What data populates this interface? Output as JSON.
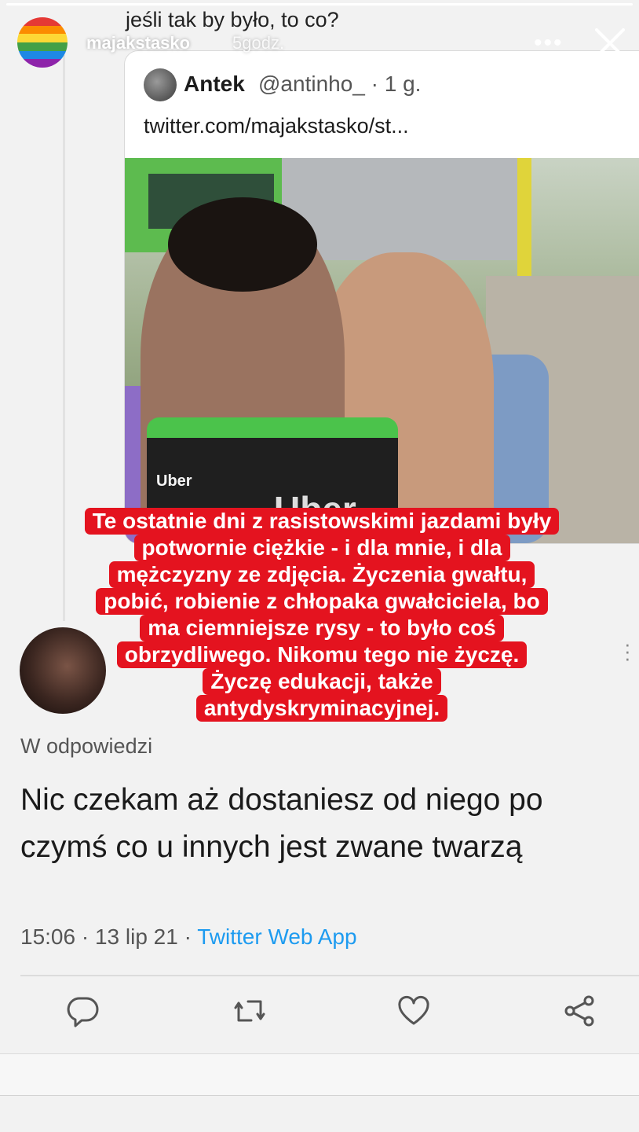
{
  "story": {
    "username": "majakstasko",
    "time": "5godz.",
    "more_icon": "•••",
    "close_icon": "close-icon",
    "progress": 1.0
  },
  "tweet_context": {
    "top_line": "jeśli tak by było, to co?"
  },
  "quoted_tweet": {
    "name": "Antek",
    "handle": "@antinho_ · 1 g.",
    "url": "twitter.com/majakstasko/st...",
    "photo": {
      "bag_brand": "Uber",
      "bag_side": "Uber"
    }
  },
  "overlay_caption": {
    "lines": [
      "Te ostatnie dni z rasistowskimi jazdami były",
      "potwornie ciężkie - i dla mnie, i dla",
      "mężczyzny ze zdjęcia. Życzenia gwałtu,",
      "pobić, robienie z chłopaka gwałciciela, bo",
      "ma ciemniejsze rysy - to było coś",
      "obrzydliwego. Nikomu tego nie życzę.",
      "Życzę edukacji, także",
      "antydyskryminacyjnej."
    ]
  },
  "reply": {
    "reply_to": "W odpowiedzi",
    "text": "Nic czekam aż dostaniesz od niego po czymś co u innych jest zwane twarzą",
    "timestamp": "15:06 · 13 lip 21 · ",
    "app": "Twitter Web App"
  },
  "actions": [
    "reply-icon",
    "retweet-icon",
    "like-icon",
    "share-icon"
  ]
}
